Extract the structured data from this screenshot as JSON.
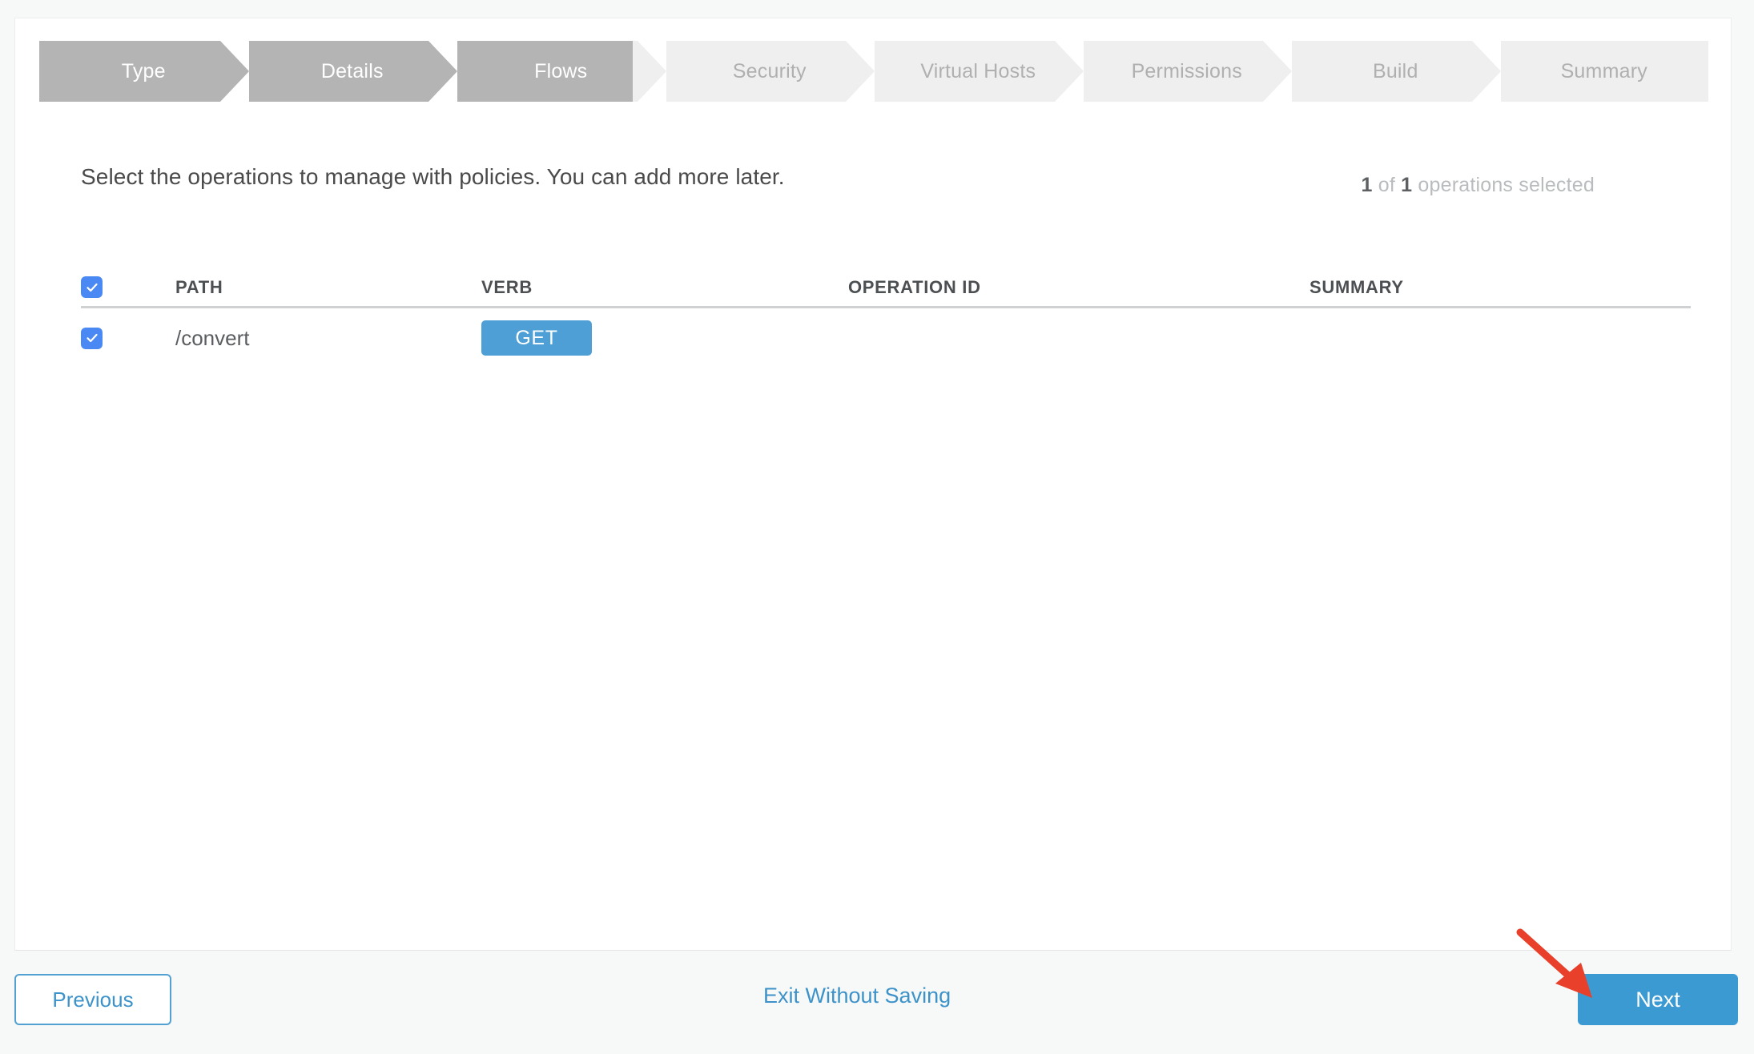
{
  "theme": {
    "page_background": "#f7f8f8",
    "card_background": "#ffffff",
    "step_done_bg": "#b4b4b4",
    "step_todo_bg": "#efefef",
    "accent_blue": "#3b9ad2",
    "link_blue": "#3d93c9",
    "checkbox_blue": "#4a89f3",
    "verb_badge_blue": "#4d9fd6",
    "annotation_red": "#e8402a"
  },
  "stepper": {
    "steps": [
      {
        "label": "Type",
        "state": "done"
      },
      {
        "label": "Details",
        "state": "done"
      },
      {
        "label": "Flows",
        "state": "done"
      },
      {
        "label": "Security",
        "state": "todo"
      },
      {
        "label": "Virtual Hosts",
        "state": "todo"
      },
      {
        "label": "Permissions",
        "state": "todo"
      },
      {
        "label": "Build",
        "state": "todo"
      },
      {
        "label": "Summary",
        "state": "todo"
      }
    ]
  },
  "main": {
    "instruction": "Select the operations to manage with policies. You can add more later.",
    "counter": {
      "selected": "1",
      "of_label": " of ",
      "total": "1",
      "suffix": " operations selected"
    },
    "table": {
      "columns": [
        "PATH",
        "VERB",
        "OPERATION ID",
        "SUMMARY"
      ],
      "select_all_checked": true,
      "rows": [
        {
          "checked": true,
          "path": "/convert",
          "verb": "GET",
          "operation_id": "",
          "summary": ""
        }
      ]
    }
  },
  "footer": {
    "previous_label": "Previous",
    "exit_label": "Exit Without Saving",
    "next_label": "Next"
  },
  "annotation": {
    "type": "arrow",
    "points_to": "next-button"
  }
}
